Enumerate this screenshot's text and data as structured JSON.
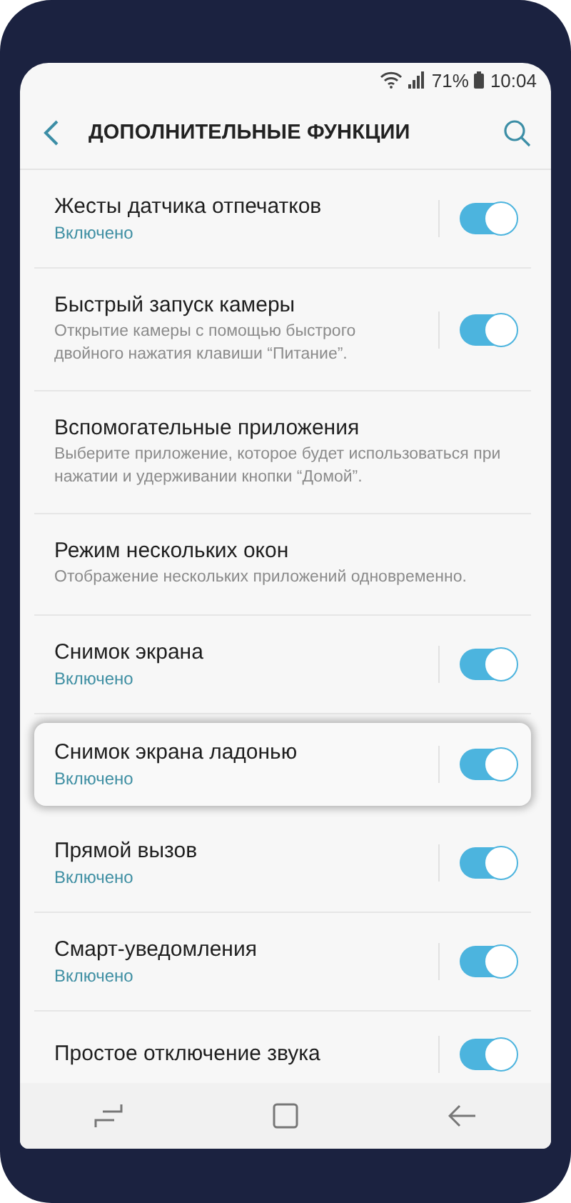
{
  "status_bar": {
    "battery": "71%",
    "time": "10:04"
  },
  "header": {
    "title": "ДОПОЛНИТЕЛЬНЫЕ ФУНКЦИИ"
  },
  "items": [
    {
      "kind": "toggle",
      "title": "Жесты датчика отпечатков",
      "subtitle": "Включено",
      "on": true,
      "highlighted": false
    },
    {
      "kind": "toggle",
      "title": "Быстрый запуск камеры",
      "description": "Открытие камеры с помощью быстрого двойного нажатия клавиши “Питание”.",
      "on": true,
      "highlighted": false
    },
    {
      "kind": "plain",
      "title": "Вспомогательные приложения",
      "description": "Выберите приложение, которое будет использоваться при нажатии и удерживании кнопки “Домой”."
    },
    {
      "kind": "plain",
      "title": "Режим нескольких окон",
      "description": "Отображение нескольких приложений одновременно."
    },
    {
      "kind": "toggle",
      "title": "Снимок экрана",
      "subtitle": "Включено",
      "on": true,
      "highlighted": false
    },
    {
      "kind": "toggle",
      "title": "Снимок экрана ладонью",
      "subtitle": "Включено",
      "on": true,
      "highlighted": true
    },
    {
      "kind": "toggle",
      "title": "Прямой вызов",
      "subtitle": "Включено",
      "on": true,
      "highlighted": false
    },
    {
      "kind": "toggle",
      "title": "Смарт-уведомления",
      "subtitle": "Включено",
      "on": true,
      "highlighted": false
    },
    {
      "kind": "toggle",
      "title": "Простое отключение звука",
      "on": true,
      "highlighted": false
    }
  ]
}
